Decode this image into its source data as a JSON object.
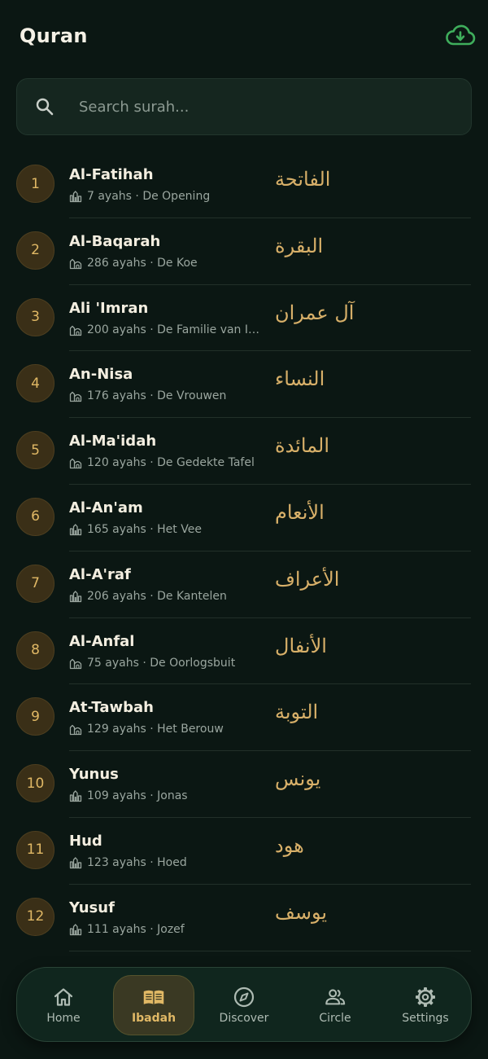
{
  "header": {
    "title": "Quran",
    "download_icon": "cloud-download-icon",
    "accent_color": "#3fae5c"
  },
  "search": {
    "placeholder": "Search surah...",
    "value": "",
    "icon": "search-icon"
  },
  "surahs": [
    {
      "number": "1",
      "name": "Al-Fatihah",
      "arabic": "الفاتحة",
      "meta": "7 ayahs · De Opening",
      "revelation": "mecca"
    },
    {
      "number": "2",
      "name": "Al-Baqarah",
      "arabic": "البقرة",
      "meta": "286 ayahs · De Koe",
      "revelation": "medina"
    },
    {
      "number": "3",
      "name": "Ali 'Imran",
      "arabic": "آل عمران",
      "meta": "200 ayahs · De Familie van Imr…",
      "revelation": "medina"
    },
    {
      "number": "4",
      "name": "An-Nisa",
      "arabic": "النساء",
      "meta": "176 ayahs · De Vrouwen",
      "revelation": "medina"
    },
    {
      "number": "5",
      "name": "Al-Ma'idah",
      "arabic": "المائدة",
      "meta": "120 ayahs · De Gedekte Tafel",
      "revelation": "medina"
    },
    {
      "number": "6",
      "name": "Al-An'am",
      "arabic": "الأنعام",
      "meta": "165 ayahs · Het Vee",
      "revelation": "mecca"
    },
    {
      "number": "7",
      "name": "Al-A'raf",
      "arabic": "الأعراف",
      "meta": "206 ayahs · De Kantelen",
      "revelation": "mecca"
    },
    {
      "number": "8",
      "name": "Al-Anfal",
      "arabic": "الأنفال",
      "meta": "75 ayahs · De Oorlogsbuit",
      "revelation": "medina"
    },
    {
      "number": "9",
      "name": "At-Tawbah",
      "arabic": "التوبة",
      "meta": "129 ayahs · Het Berouw",
      "revelation": "medina"
    },
    {
      "number": "10",
      "name": "Yunus",
      "arabic": "يونس",
      "meta": "109 ayahs · Jonas",
      "revelation": "mecca"
    },
    {
      "number": "11",
      "name": "Hud",
      "arabic": "هود",
      "meta": "123 ayahs · Hoed",
      "revelation": "mecca"
    },
    {
      "number": "12",
      "name": "Yusuf",
      "arabic": "يوسف",
      "meta": "111 ayahs · Jozef",
      "revelation": "mecca"
    }
  ],
  "nav": [
    {
      "label": "Home",
      "icon": "home-icon",
      "active": false
    },
    {
      "label": "Ibadah",
      "icon": "book-icon",
      "active": true
    },
    {
      "label": "Discover",
      "icon": "compass-icon",
      "active": false
    },
    {
      "label": "Circle",
      "icon": "people-icon",
      "active": false
    },
    {
      "label": "Settings",
      "icon": "gear-icon",
      "active": false
    }
  ],
  "colors": {
    "background": "#0b1713",
    "gold": "#e0b865",
    "arabic_gold": "#d8b069",
    "muted": "#9aa69f"
  }
}
